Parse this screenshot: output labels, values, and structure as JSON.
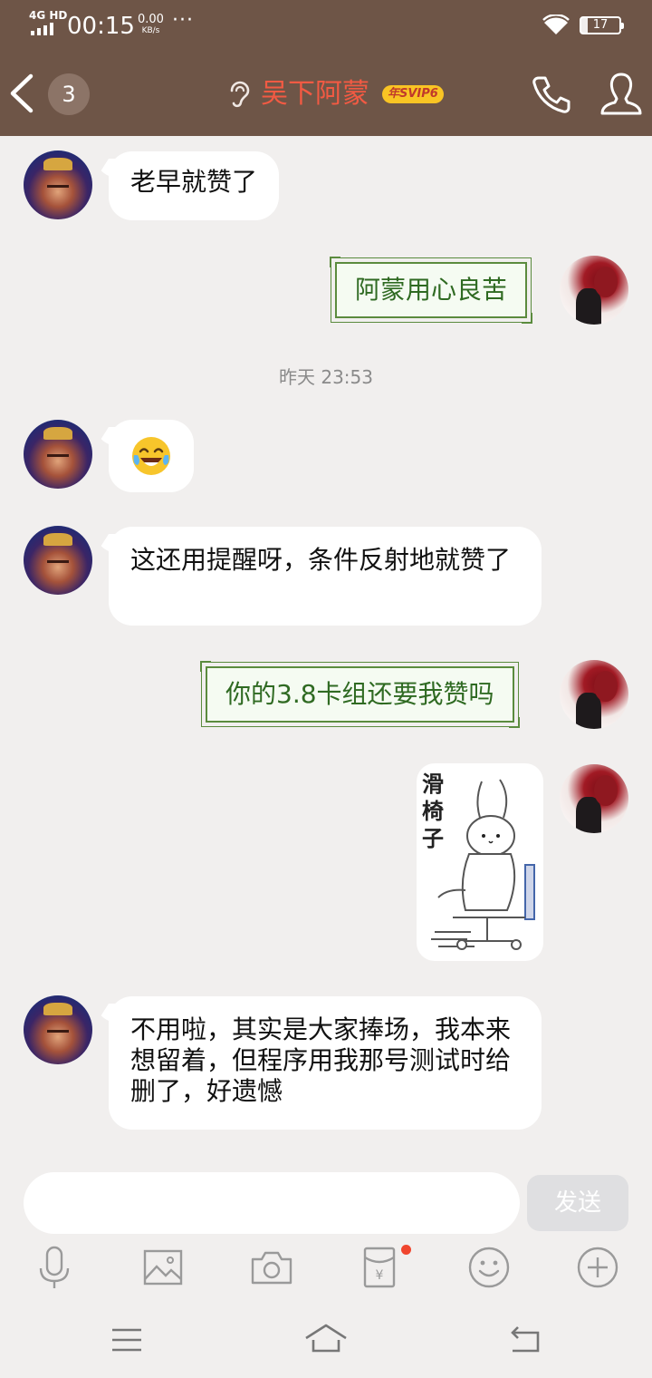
{
  "status_bar": {
    "network": "4G HD",
    "time": "00:15",
    "speed_value": "0.00",
    "speed_unit": "KB/s",
    "more": "···",
    "battery": "17"
  },
  "header": {
    "back_icon": "chevron-left-icon",
    "unread_count": "3",
    "ear_icon": "ear-icon",
    "contact_name": "吴下阿蒙",
    "vip_badge": "年SVIP6",
    "call_icon": "phone-icon",
    "profile_icon": "person-icon"
  },
  "messages": [
    {
      "side": "left",
      "text": "老早就赞了"
    },
    {
      "side": "right",
      "style": "green-frame",
      "text": "阿蒙用心良苦"
    },
    {
      "type": "time",
      "text": "昨天 23:53"
    },
    {
      "side": "left",
      "emoji": "laughing-tears-emoji"
    },
    {
      "side": "left",
      "text": "这还用提醒呀，条件反射地就赞了"
    },
    {
      "side": "right",
      "style": "green-frame",
      "text": "你的3.8卡组还要我赞吗"
    },
    {
      "side": "right",
      "type": "sticker",
      "sticker_text": "滑椅子"
    },
    {
      "side": "left",
      "text": "不用啦，其实是大家捧场，我本来想留着，但程序用我那号测试时给删了，好遗憾"
    }
  ],
  "input": {
    "value": "",
    "send_label": "发送"
  },
  "toolbar": [
    "microphone-icon",
    "image-icon",
    "camera-icon",
    "red-packet-icon",
    "emoji-icon",
    "plus-icon"
  ],
  "nav_bar": [
    "menu-icon",
    "home-icon",
    "back-icon"
  ],
  "colors": {
    "header_bg": "#6e5547",
    "chat_bg": "#f1efee",
    "name_color": "#f25a43",
    "vip_badge": "#f9c424",
    "green_text": "#2f6a22"
  }
}
